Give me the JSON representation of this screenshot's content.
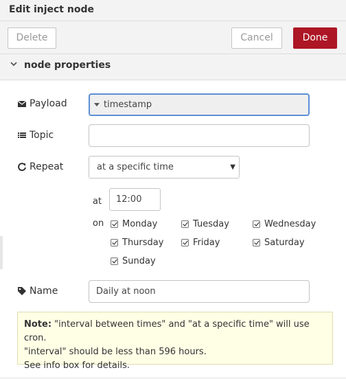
{
  "tray": {
    "title": "Edit inject node"
  },
  "toolbar": {
    "delete_label": "Delete",
    "cancel_label": "Cancel",
    "done_label": "Done"
  },
  "section": {
    "title": "node properties",
    "expanded": true
  },
  "form": {
    "payload": {
      "label": "Payload",
      "value": "timestamp",
      "icon": "envelope-icon"
    },
    "topic": {
      "label": "Topic",
      "value": "",
      "icon": "list-icon"
    },
    "repeat": {
      "label": "Repeat",
      "selected": "at a specific time",
      "icon": "refresh-icon"
    },
    "at_label": "at",
    "time_value": "12:00",
    "on_label": "on",
    "days": [
      {
        "label": "Monday",
        "checked": true
      },
      {
        "label": "Tuesday",
        "checked": true
      },
      {
        "label": "Wednesday",
        "checked": true
      },
      {
        "label": "Thursday",
        "checked": true
      },
      {
        "label": "Friday",
        "checked": true
      },
      {
        "label": "Saturday",
        "checked": true
      },
      {
        "label": "Sunday",
        "checked": true
      }
    ],
    "name": {
      "label": "Name",
      "value": "Daily at noon",
      "icon": "tag-icon"
    }
  },
  "note": {
    "bold": "Note:",
    "line1": " \"interval between times\" and \"at a specific time\" will use cron.",
    "line2": "\"interval\" should be less than 596 hours.",
    "line3": "See info box for details."
  },
  "colors": {
    "done": "#ad1625",
    "focus": "#5c8fd6",
    "note_bg": "#ffffe6"
  }
}
